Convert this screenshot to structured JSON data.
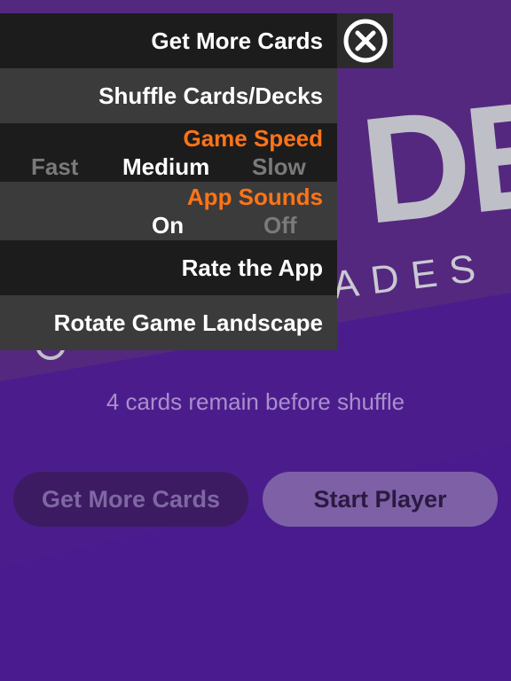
{
  "menu": {
    "get_more_cards": "Get More Cards",
    "shuffle": "Shuffle Cards/Decks",
    "game_speed": {
      "title": "Game Speed",
      "options": [
        "Fast",
        "Medium",
        "Slow"
      ],
      "selected": "Medium"
    },
    "app_sounds": {
      "title": "App Sounds",
      "options": [
        "On",
        "Off"
      ],
      "selected": "On"
    },
    "rate": "Rate the App",
    "rotate": "Rotate Game Landscape"
  },
  "background": {
    "logo_letters": "DE",
    "logo_subtitle": "ADES"
  },
  "main": {
    "remaining_text": "4 cards remain before shuffle",
    "get_more_button": "Get More Cards",
    "start_button": "Start Player"
  },
  "colors": {
    "accent": "#ff7417",
    "menu_dark": "#1c1c1c",
    "menu_mid": "#3b3b3b",
    "background": "#4a1f88"
  },
  "icons": {
    "close": "close-circle-icon"
  }
}
